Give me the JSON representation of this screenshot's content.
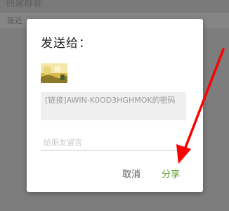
{
  "background": {
    "title": "创建群聊",
    "section_label": "最近"
  },
  "dialog": {
    "title": "发送给：",
    "link_text": "[链接]AWIN-K0OD3HGHMOK的密码",
    "message_placeholder": "给朋友留言",
    "message_value": "",
    "cancel_label": "取消",
    "share_label": "分享"
  },
  "colors": {
    "accent": "#5aa032",
    "annotation_arrow": "#ff0000"
  },
  "icons": {
    "recipient_avatar": "recipient-thumbnail",
    "annotation": "red-arrow-pointer"
  }
}
